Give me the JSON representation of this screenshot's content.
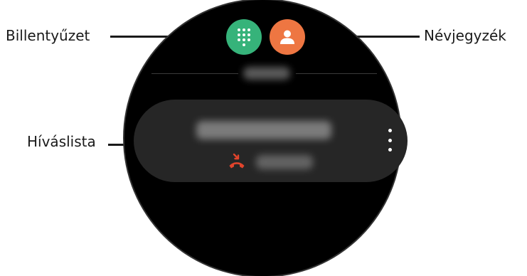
{
  "callouts": {
    "keypad": "Billentyűzet",
    "contacts": "Névjegyzék",
    "call_log": "Híváslista"
  },
  "buttons": {
    "keypad_icon": "dial-pad-icon",
    "contacts_icon": "person-icon",
    "more_icon": "more-options-icon",
    "missed_call_icon": "missed-call-icon"
  },
  "colors": {
    "keypad_button": "#36b37a",
    "contacts_button": "#ee7642",
    "missed_call": "#e0442c",
    "screen": "#000000",
    "card": "#262626"
  }
}
